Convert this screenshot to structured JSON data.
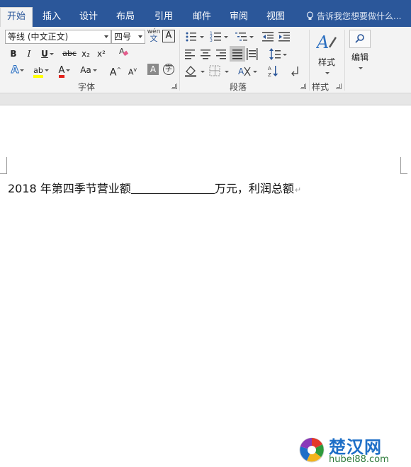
{
  "ribbon": {
    "tabs": [
      {
        "label": "开始",
        "active": true
      },
      {
        "label": "插入"
      },
      {
        "label": "设计"
      },
      {
        "label": "布局"
      },
      {
        "label": "引用"
      },
      {
        "label": "邮件"
      },
      {
        "label": "审阅"
      },
      {
        "label": "视图"
      }
    ],
    "tell_me": "告诉我您想要做什么...",
    "font": {
      "family": "等线 (中文正文)",
      "size": "四号",
      "phonetic_top": "wén",
      "phonetic_bottom": "文",
      "char_border": "A",
      "bold": "B",
      "italic": "I",
      "underline": "U",
      "strike": "abc",
      "sub": "x₂",
      "sup": "x²",
      "highlight": "ab",
      "font_color": "A",
      "change_case": "Aa",
      "grow": "A",
      "shrink": "A",
      "shading": "A",
      "enclose": "字",
      "effects": "A",
      "group_label": "字体"
    },
    "paragraph": {
      "group_label": "段落"
    },
    "styles": {
      "button_label": "样式",
      "group_label": "样式"
    },
    "editing": {
      "button_label": "编辑"
    }
  },
  "document": {
    "text_before": "2018 年第四季节营业额",
    "text_after": "万元，利润总额",
    "para_mark": "↵"
  },
  "watermark": {
    "title": "楚汉网",
    "url": "hubei88.com"
  },
  "colors": {
    "ribbon_blue": "#2b579a",
    "highlight": "#ffff00",
    "font_red": "#e3221b"
  }
}
